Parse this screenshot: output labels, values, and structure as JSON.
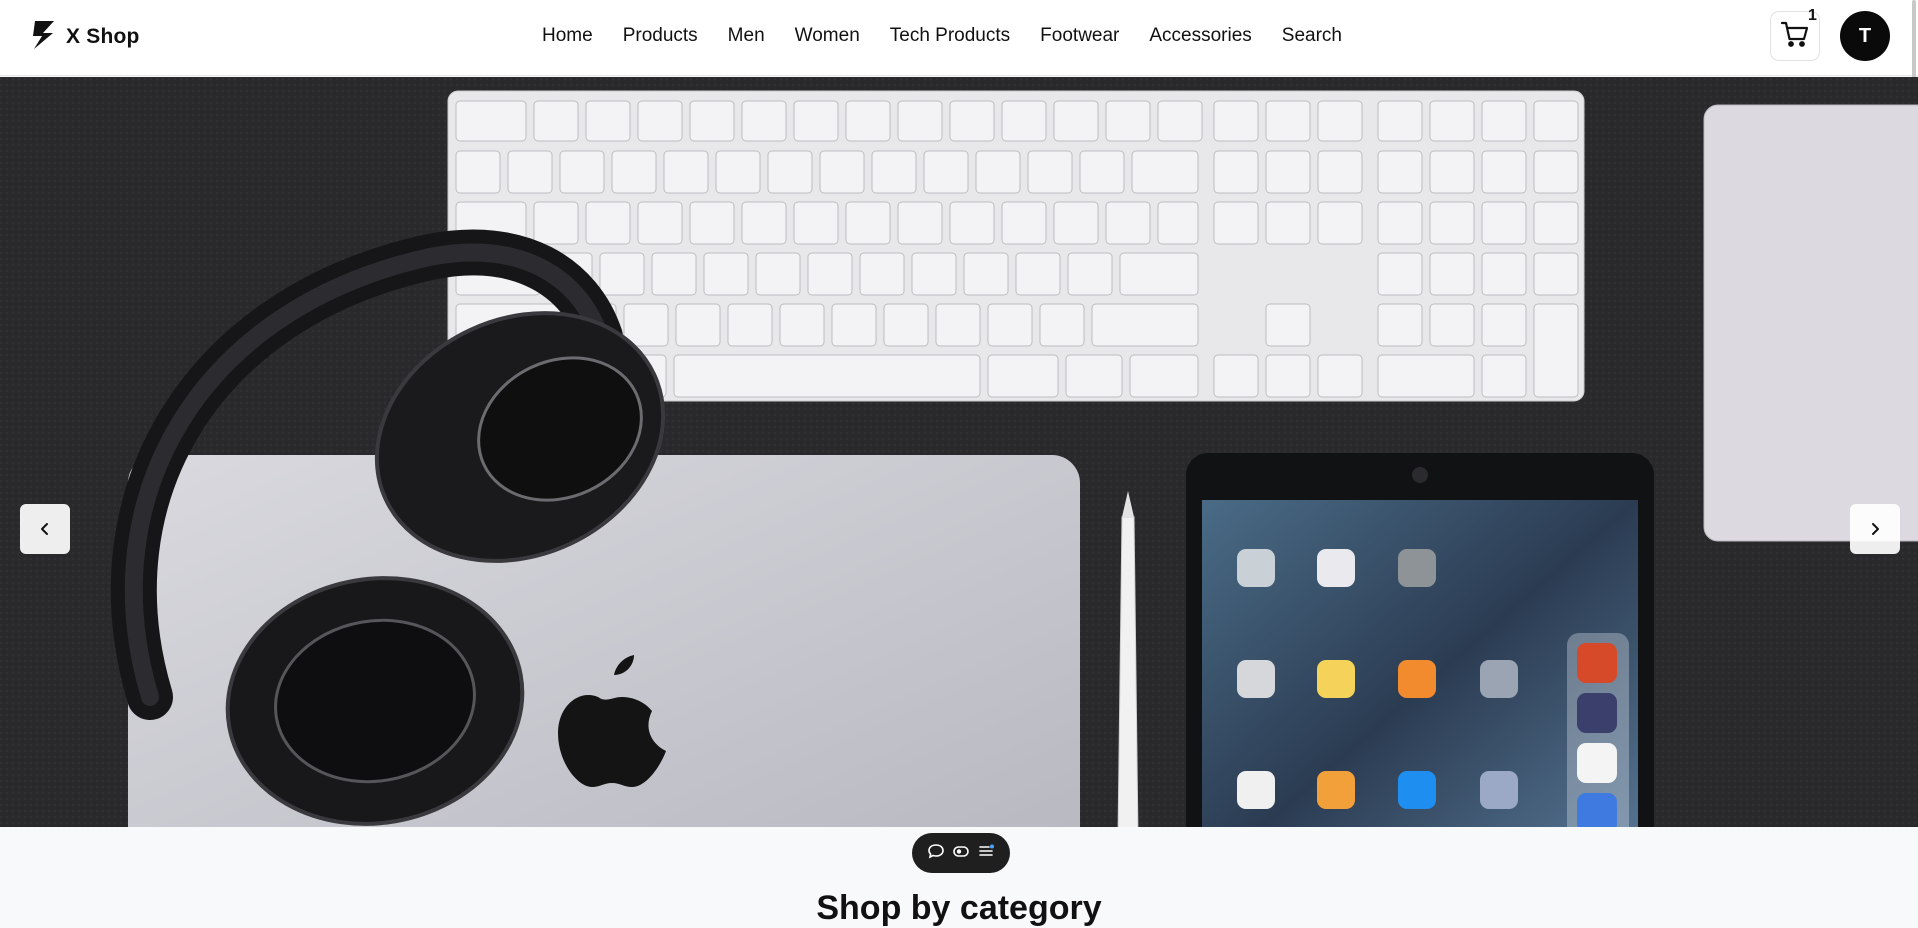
{
  "brand": {
    "name": "X Shop",
    "logo_icon": "zap-logo-icon"
  },
  "nav": {
    "items": [
      "Home",
      "Products",
      "Men",
      "Women",
      "Tech Products",
      "Footwear",
      "Accessories",
      "Search"
    ]
  },
  "cart": {
    "count": "1",
    "icon": "shopping-cart-icon"
  },
  "user": {
    "avatar_initial": "T"
  },
  "hero": {
    "image_icon": "hero-image",
    "prev_icon": "chevron-left-icon",
    "next_icon": "chevron-right-icon"
  },
  "toolbar": {
    "icons": [
      "comment-icon",
      "toggle-icon",
      "menu-list-icon"
    ]
  },
  "section": {
    "title": "Shop by category"
  },
  "colors": {
    "accent": "#0a0a0a",
    "header_bg": "#ffffff",
    "page_bg": "#f8f9fa",
    "hero_bg": "#27272a"
  }
}
